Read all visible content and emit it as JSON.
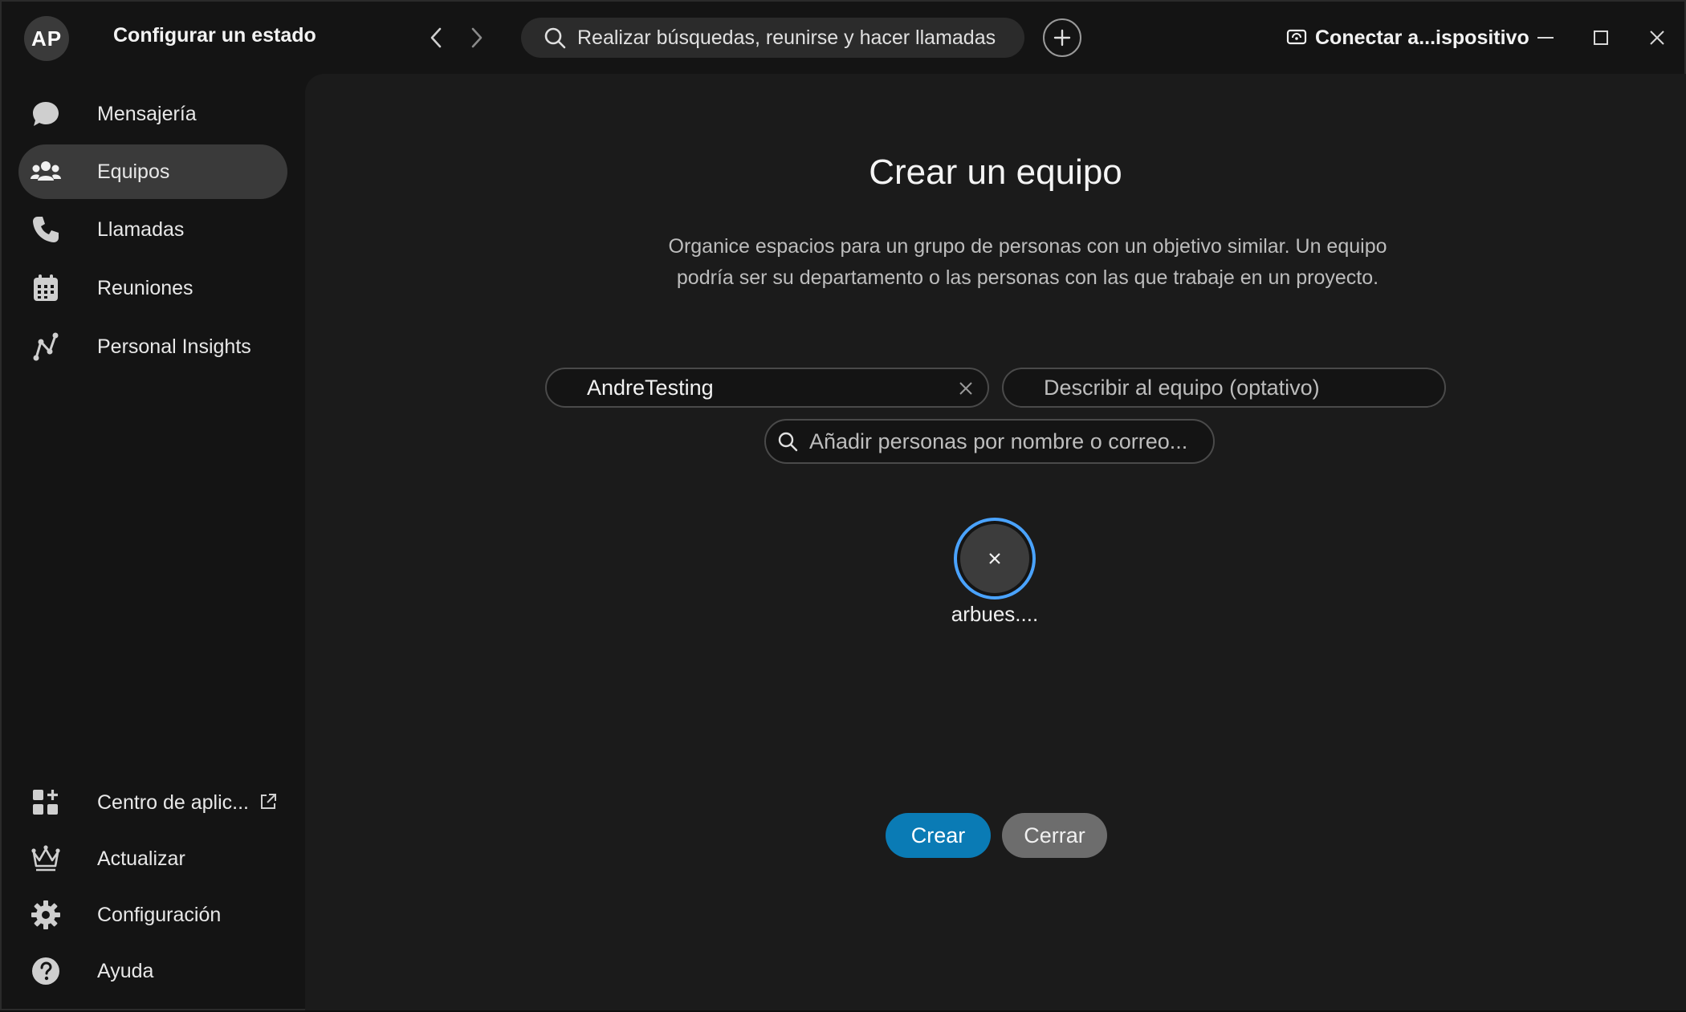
{
  "titlebar": {
    "avatar_initials": "AP",
    "status": "Configurar un estado",
    "search_placeholder": "Realizar búsquedas, reunirse y hacer llamadas",
    "connect_label": "Conectar a...ispositivo"
  },
  "sidebar": {
    "items": [
      {
        "label": "Mensajería",
        "icon": "chat-bubble-icon"
      },
      {
        "label": "Equipos",
        "icon": "people-icon",
        "active": true
      },
      {
        "label": "Llamadas",
        "icon": "phone-icon"
      },
      {
        "label": "Reuniones",
        "icon": "calendar-icon"
      },
      {
        "label": "Personal Insights",
        "icon": "insights-icon"
      }
    ],
    "bottom_items": [
      {
        "label": "Centro de aplic...",
        "icon": "app-grid-icon"
      },
      {
        "label": "Actualizar",
        "icon": "crown-icon"
      },
      {
        "label": "Configuración",
        "icon": "gear-icon"
      },
      {
        "label": "Ayuda",
        "icon": "help-icon"
      }
    ]
  },
  "dialog": {
    "title": "Crear un equipo",
    "description": "Organice espacios para un grupo de personas con un objetivo similar. Un equipo podría ser su departamento o las personas con las que trabaje en un proyecto.",
    "team_name_value": "AndreTesting",
    "team_description_placeholder": "Describir al equipo (optativo)",
    "add_people_placeholder": "Añadir personas por nombre o correo...",
    "selected_person": "arbues....",
    "create_label": "Crear",
    "close_label": "Cerrar"
  },
  "colors": {
    "accent": "#0a7bb5",
    "chip_ring": "#4aa3ff",
    "background": "#141414",
    "panel": "#1b1b1b"
  }
}
